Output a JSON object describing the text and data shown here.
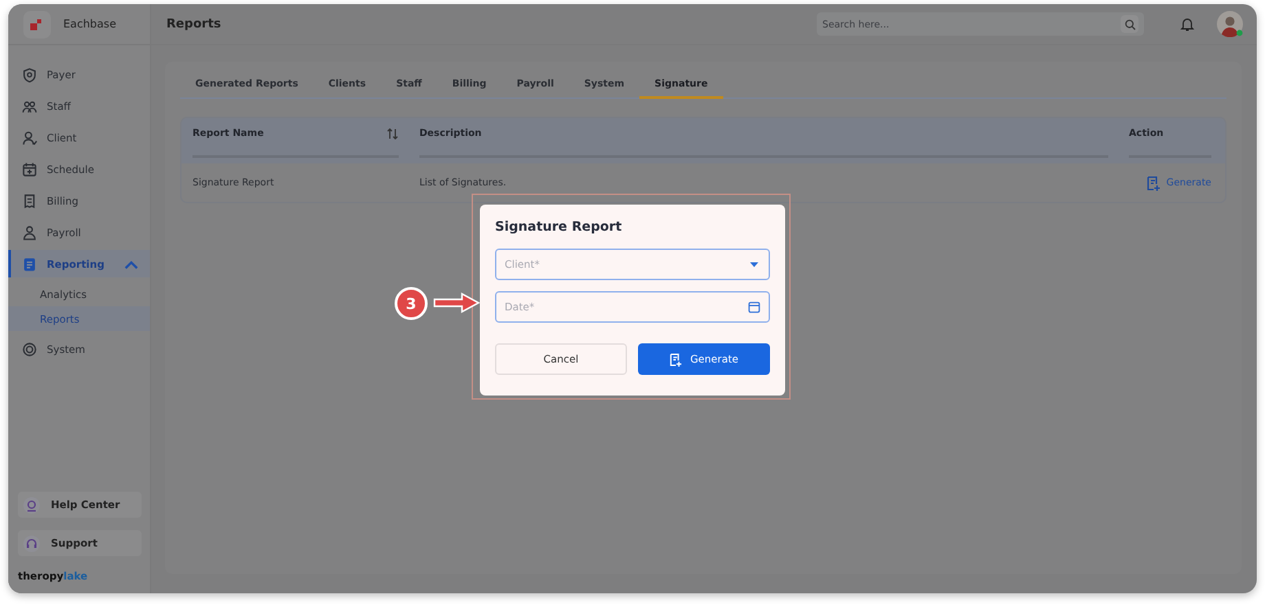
{
  "brand": {
    "name": "Eachbase"
  },
  "header": {
    "title": "Reports",
    "search": {
      "placeholder": "Search here..."
    }
  },
  "sidebar": {
    "items": [
      {
        "label": "Payer",
        "selected": false
      },
      {
        "label": "Staff",
        "selected": false
      },
      {
        "label": "Client",
        "selected": false
      },
      {
        "label": "Schedule",
        "selected": false
      },
      {
        "label": "Billing",
        "selected": false
      },
      {
        "label": "Payroll",
        "selected": false
      },
      {
        "label": "Reporting",
        "selected": true,
        "expanded": true,
        "children": [
          {
            "label": "Analytics",
            "selected": false
          },
          {
            "label": "Reports",
            "selected": true
          }
        ]
      },
      {
        "label": "System",
        "selected": false
      }
    ],
    "links": [
      {
        "label": "Help Center"
      },
      {
        "label": "Support"
      }
    ],
    "logo": {
      "first": "theropy",
      "second": "lake"
    }
  },
  "tabs": [
    {
      "label": "Generated Reports",
      "selected": false
    },
    {
      "label": "Clients",
      "selected": false
    },
    {
      "label": "Staff",
      "selected": false
    },
    {
      "label": "Billing",
      "selected": false
    },
    {
      "label": "Payroll",
      "selected": false
    },
    {
      "label": "System",
      "selected": false
    },
    {
      "label": "Signature",
      "selected": true
    }
  ],
  "table": {
    "columns": [
      {
        "label": "Report Name",
        "sortable": true
      },
      {
        "label": "Description",
        "sortable": false
      },
      {
        "label": "Action",
        "sortable": false
      }
    ],
    "rows": [
      {
        "name": "Signature Report",
        "description": "List of Signatures.",
        "action": "Generate"
      }
    ]
  },
  "dialog": {
    "title": "Signature Report",
    "fields": [
      {
        "kind": "select",
        "placeholder": "Client*"
      },
      {
        "kind": "date",
        "placeholder": "Date*"
      }
    ],
    "buttons": [
      {
        "kind": "secondary",
        "label": "Cancel"
      },
      {
        "kind": "primary",
        "label": "Generate"
      }
    ]
  },
  "annotation": {
    "label": "3"
  }
}
